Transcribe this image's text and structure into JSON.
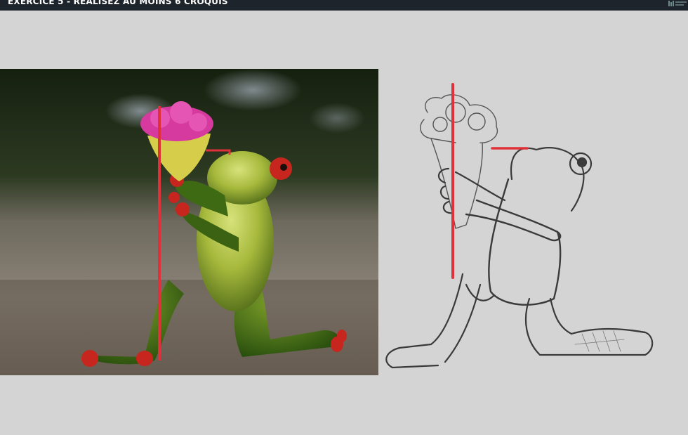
{
  "header": {
    "title": "EXERCICE 5 - RÉALISEZ AU MOINS 6 CROQUIS"
  },
  "colors": {
    "topbar": "#1e242b",
    "background": "#d4d4d4",
    "guide_line": "#e0303a",
    "sketch_stroke": "#3a3a3a"
  },
  "icons": {
    "logo": "brand-logo-icon"
  }
}
